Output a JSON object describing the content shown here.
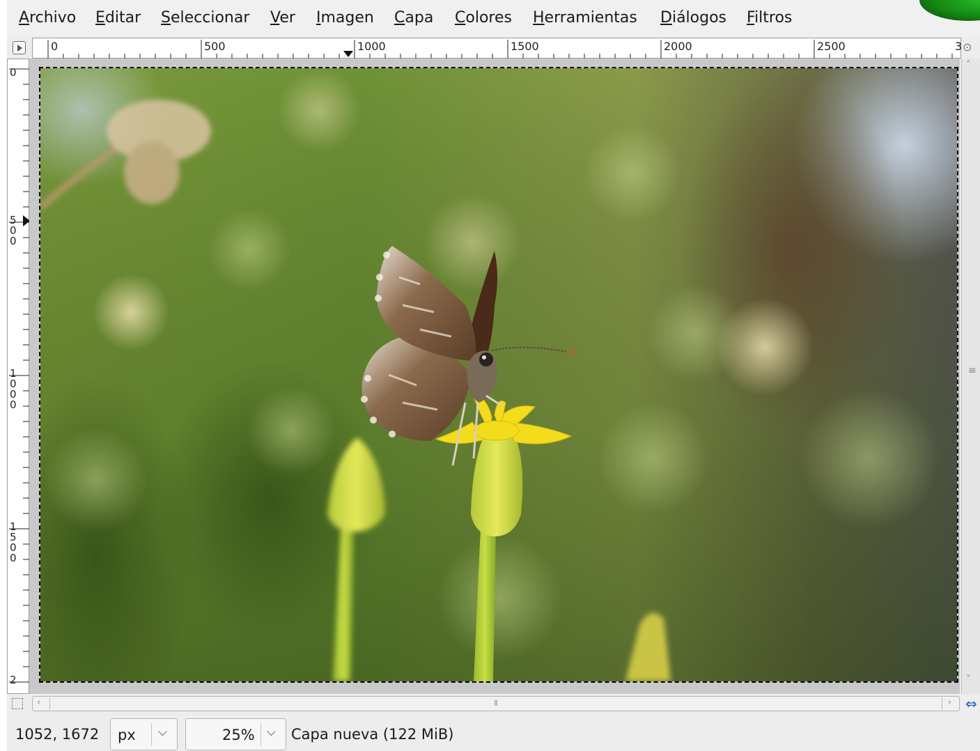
{
  "menu": {
    "items": [
      {
        "mnemonic": "A",
        "rest": "rchivo"
      },
      {
        "mnemonic": "E",
        "rest": "ditar"
      },
      {
        "mnemonic": "S",
        "rest": "eleccionar"
      },
      {
        "mnemonic": "V",
        "rest": "er"
      },
      {
        "mnemonic": "I",
        "rest": "magen"
      },
      {
        "mnemonic": "C",
        "rest": "apa"
      },
      {
        "mnemonic": "C",
        "rest": "olores"
      },
      {
        "mnemonic": "H",
        "rest": "erramientas"
      },
      {
        "mnemonic": "D",
        "rest": "iálogos"
      },
      {
        "mnemonic": "F",
        "rest": "iltros"
      }
    ]
  },
  "hruler": {
    "labels": [
      "0",
      "500",
      "1000",
      "1500",
      "2000",
      "2500",
      "3"
    ]
  },
  "vruler": {
    "labels": [
      "0",
      "500",
      "1000",
      "1500",
      "2"
    ]
  },
  "status": {
    "coords": "1052, 1672",
    "unit": "px",
    "zoom": "25%",
    "layer": "Capa nueva (122 MiB)"
  },
  "icons": {
    "nav_toggle": "navigation-toggle-icon",
    "zoom_ruler": "zoom-icon",
    "quick_mask": "quick-mask-icon",
    "navigate": "navigate-icon",
    "scroll_grip": "scroll-grip-icon",
    "combo_arrow": "chevron-down-icon"
  },
  "glyphs": {
    "chevron": "⌵",
    "arrow_left": "‹",
    "arrow_right": "›",
    "arrow_up": "˄",
    "arrow_down": "˅",
    "grip_v": "≡",
    "grip_h": "⦀",
    "navigate": "⇔",
    "zoom": "⊙"
  },
  "colors": {
    "selection_marching_ants": "#f4e25a",
    "navigate_icon": "#1f5fbf"
  }
}
